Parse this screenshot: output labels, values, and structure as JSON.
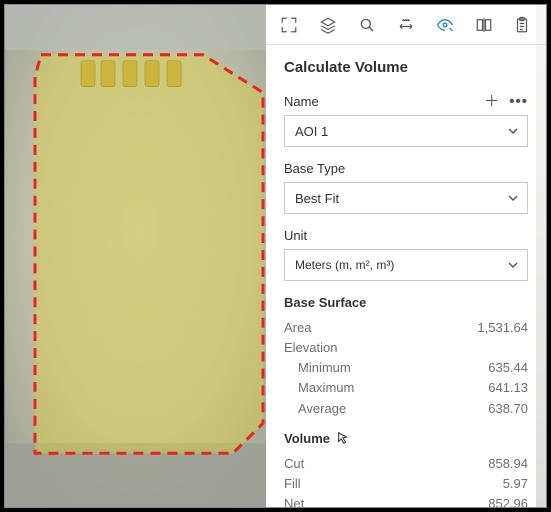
{
  "panel": {
    "title": "Calculate Volume",
    "name": {
      "label": "Name",
      "value": "AOI 1"
    },
    "base_type": {
      "label": "Base Type",
      "value": "Best Fit"
    },
    "unit": {
      "label": "Unit",
      "value": "Meters (m, m², m³)"
    },
    "base_surface": {
      "heading": "Base Surface",
      "area_label": "Area",
      "area_value": "1,531.64",
      "elevation_label": "Elevation",
      "min_label": "Minimum",
      "min_value": "635.44",
      "max_label": "Maximum",
      "max_value": "641.13",
      "avg_label": "Average",
      "avg_value": "638.70"
    },
    "volume": {
      "heading": "Volume",
      "cut_label": "Cut",
      "cut_value": "858.94",
      "fill_label": "Fill",
      "fill_value": "5.97",
      "net_label": "Net",
      "net_value": "852.96"
    }
  },
  "toolbar": {
    "tools": [
      "extent",
      "layers",
      "search",
      "measure",
      "view-3d",
      "compare",
      "clipboard"
    ],
    "active": "view-3d"
  },
  "aoi": {
    "name": "AOI 1",
    "highlight_color": "#dccf3f",
    "outline_color": "#e3271c"
  }
}
